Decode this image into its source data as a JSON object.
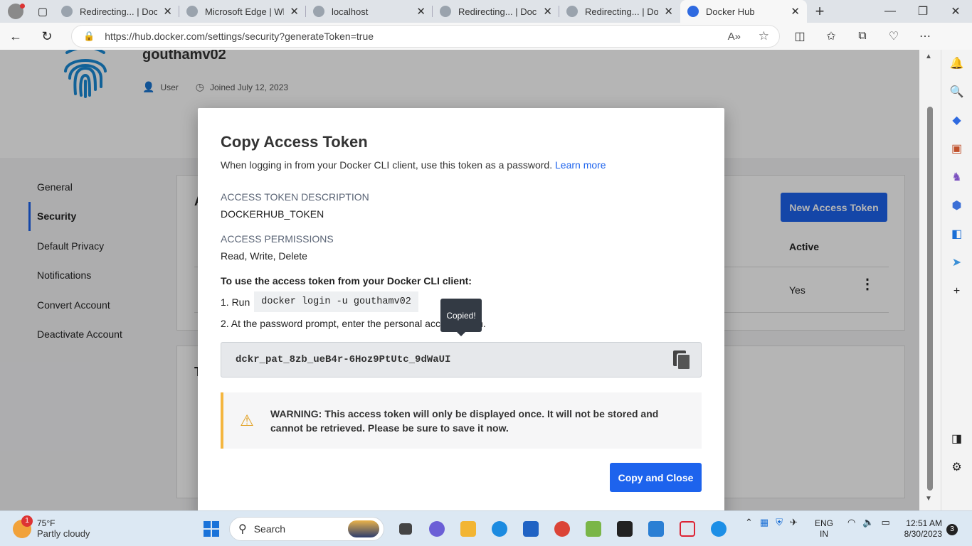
{
  "browser": {
    "tabs": [
      {
        "title": "Redirecting... | Docker",
        "active": false
      },
      {
        "title": "Microsoft Edge | What",
        "active": false
      },
      {
        "title": "localhost",
        "active": false
      },
      {
        "title": "Redirecting... | Docker",
        "active": false
      },
      {
        "title": "Redirecting... | Docker",
        "active": false
      },
      {
        "title": "Docker Hub",
        "active": true
      }
    ],
    "url": "https://hub.docker.com/settings/security?generateToken=true"
  },
  "profile": {
    "username": "gouthamv02",
    "role": "User",
    "joined": "Joined July 12, 2023"
  },
  "settings_nav": {
    "items": [
      "General",
      "Security",
      "Default Privacy",
      "Notifications",
      "Convert Account",
      "Deactivate Account"
    ],
    "selected": "Security"
  },
  "background_card": {
    "new_token_button": "New Access Token",
    "column_active": "Active",
    "row_active_value": "Yes",
    "partial_heading": "A",
    "partial_heading2": "T"
  },
  "modal": {
    "title": "Copy Access Token",
    "subtitle": "When logging in from your Docker CLI client, use this token as a password.",
    "learn_more": "Learn more",
    "desc_label": "ACCESS TOKEN DESCRIPTION",
    "desc_value": "DOCKERHUB_TOKEN",
    "perm_label": "ACCESS PERMISSIONS",
    "perm_value": "Read, Write, Delete",
    "instructions_title": "To use the access token from your Docker CLI client:",
    "step1_prefix": "1. Run",
    "step1_command": "docker login -u gouthamv02",
    "step2": "2. At the password prompt, enter the personal access token.",
    "tooltip": "Copied!",
    "token": "dckr_pat_8zb_ueB4r-6Hoz9PtUtc_9dWaUI",
    "warning": "WARNING: This access token will only be displayed once. It will not be stored and cannot be retrieved. Please be sure to save it now.",
    "copy_close_button": "Copy and Close"
  },
  "taskbar": {
    "weather_temp": "75°F",
    "weather_desc": "Partly cloudy",
    "weather_badge": "1",
    "search_placeholder": "Search",
    "lang_1": "ENG",
    "lang_2": "IN",
    "time": "12:51 AM",
    "date": "8/30/2023",
    "notifications": "3"
  },
  "colors": {
    "accent": "#1d63ed",
    "warning": "#f4b63f"
  }
}
